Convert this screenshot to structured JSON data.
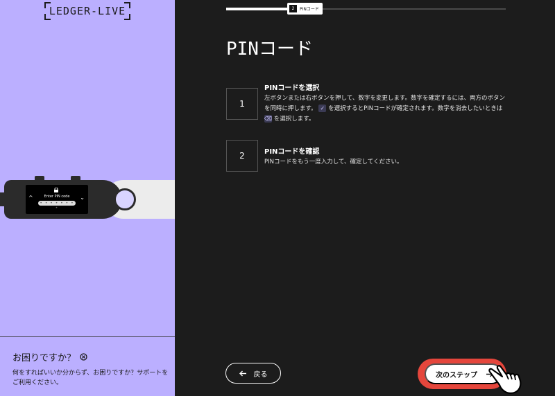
{
  "left_panel": {
    "logo": "LEDGER-LIVE",
    "device": {
      "screen_prompt": "Enter PIN code",
      "pin_dots": "• • • • • • • •",
      "left_arrow": "^",
      "right_arrow": "⌄",
      "lock_icon": "lock-icon"
    },
    "help": {
      "title": "お困りですか？",
      "icon": "help-circle-icon",
      "text": "何をすればいいか分からず、お困りですか？サポートをご利用ください。"
    }
  },
  "progress": {
    "step_number": "2",
    "step_label": "PINコード",
    "fraction": 0.22
  },
  "main": {
    "title": "PINコード",
    "steps": [
      {
        "number": "1",
        "heading": "PINコードを選択",
        "desc_part1": "左ボタンまたは右ボタンを押して、数字を変更します。数字を確定するには、両方のボタンを同時に押します。",
        "check_icon": "check-icon",
        "desc_part2": "を選択するとPINコードが確定されます。数字を消去したいときは",
        "backspace_icon": "backspace-icon",
        "desc_part3": "を選択します。"
      },
      {
        "number": "2",
        "heading": "PINコードを確認",
        "desc": "PINコードをもう一度入力して、確定してください。"
      }
    ]
  },
  "footer": {
    "back_label": "戻る",
    "back_icon": "arrow-left-icon",
    "next_label": "次のステップ",
    "next_icon": "arrow-right-icon",
    "cursor_icon": "hand-pointer-icon",
    "highlight_color": "#e5463c"
  }
}
